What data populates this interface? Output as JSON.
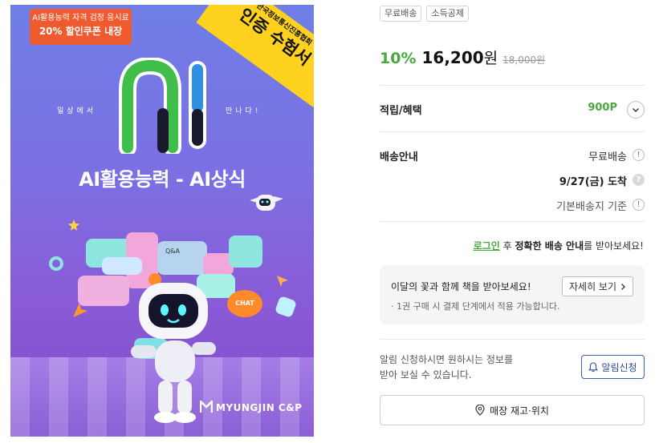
{
  "cover": {
    "coupon_line1": "AI활용능력 자격 검정 응시료",
    "coupon_line2": "20% 할인쿠폰 내장",
    "ribbon_line1": "한국정보통신진흥협회",
    "ribbon_line2": "인증 수험서",
    "side_left": "일상에서",
    "side_right": "만나다!",
    "logo_text": "AI",
    "title": "AI활용능력 - AI상식",
    "bubble_qa": "Q&A",
    "bubble_chat": "CHAT",
    "publisher": "MYUNGJIN C&P"
  },
  "tags": [
    "무료배송",
    "소득공제"
  ],
  "price": {
    "discount": "10%",
    "sale": "16,200",
    "unit": "원",
    "original": "18,000원"
  },
  "benefit": {
    "label": "적립/혜택",
    "points": "900P"
  },
  "shipping": {
    "label": "배송안내",
    "free": "무료배송",
    "arrival": "9/27(금) 도착",
    "base": "기본배송지 기준"
  },
  "login_notice": {
    "link": "로그인",
    "after": " 후 ",
    "bold": "정확한 배송 안내",
    "tail": "를 받아보세요!"
  },
  "promo": {
    "title": "이달의 꽃과 함께 책을 받아보세요!",
    "button": "자세히 보기",
    "note": "· 1권 구매 시 결제 단계에서 적용 가능합니다."
  },
  "alarm": {
    "line1": "알림 신청하시면 원하시는 정보를",
    "line2": "받아 보실 수 있습니다.",
    "button": "알림신청"
  },
  "store_button": "매장 재고·위치",
  "colors": {
    "accent_green": "#4aa83f",
    "coupon_orange": "#ef5b2f",
    "ribbon_yellow": "#ffd21f",
    "alarm_blue": "#3f5fb8"
  }
}
